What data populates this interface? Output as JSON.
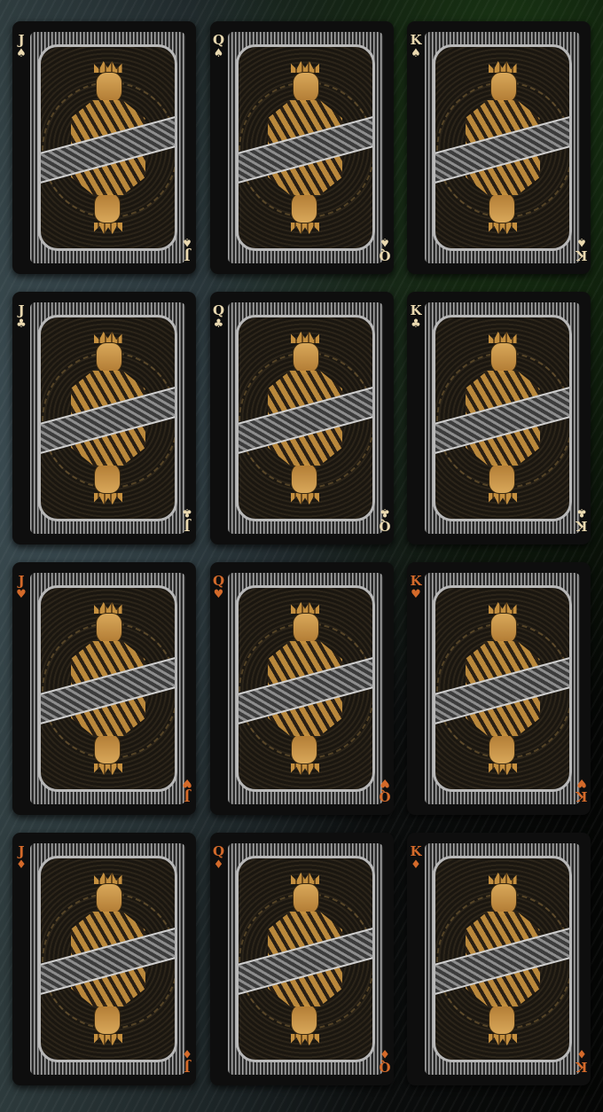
{
  "colors": {
    "ink": "#ead9b0",
    "red": "#d46a2a",
    "gold": "#c48f3f",
    "silver": "#b8b8b8"
  },
  "cards": [
    {
      "rank": "J",
      "suit": "♠",
      "suit_name": "spades",
      "color": "ink"
    },
    {
      "rank": "Q",
      "suit": "♠",
      "suit_name": "spades",
      "color": "ink"
    },
    {
      "rank": "K",
      "suit": "♠",
      "suit_name": "spades",
      "color": "ink"
    },
    {
      "rank": "J",
      "suit": "♣",
      "suit_name": "clubs",
      "color": "ink"
    },
    {
      "rank": "Q",
      "suit": "♣",
      "suit_name": "clubs",
      "color": "ink"
    },
    {
      "rank": "K",
      "suit": "♣",
      "suit_name": "clubs",
      "color": "ink"
    },
    {
      "rank": "J",
      "suit": "♥",
      "suit_name": "hearts",
      "color": "red"
    },
    {
      "rank": "Q",
      "suit": "♥",
      "suit_name": "hearts",
      "color": "red"
    },
    {
      "rank": "K",
      "suit": "♥",
      "suit_name": "hearts",
      "color": "red"
    },
    {
      "rank": "J",
      "suit": "♦",
      "suit_name": "diamonds",
      "color": "red"
    },
    {
      "rank": "Q",
      "suit": "♦",
      "suit_name": "diamonds",
      "color": "red"
    },
    {
      "rank": "K",
      "suit": "♦",
      "suit_name": "diamonds",
      "color": "red"
    }
  ]
}
